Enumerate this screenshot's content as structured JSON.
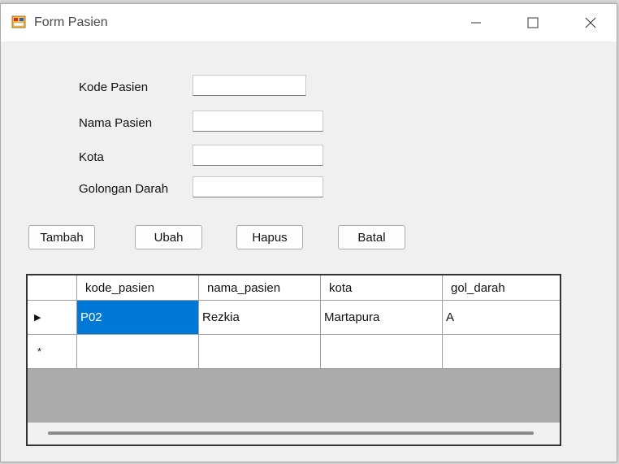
{
  "window": {
    "title": "Form Pasien",
    "controls": {
      "minimize": "minimize",
      "maximize": "maximize",
      "close": "close"
    }
  },
  "form": {
    "fields": [
      {
        "label": "Kode Pasien",
        "value": ""
      },
      {
        "label": "Nama Pasien",
        "value": ""
      },
      {
        "label": "Kota",
        "value": ""
      },
      {
        "label": "Golongan Darah",
        "value": ""
      }
    ]
  },
  "buttons": {
    "tambah": "Tambah",
    "ubah": "Ubah",
    "hapus": "Hapus",
    "batal": "Batal"
  },
  "grid": {
    "columns": [
      "kode_pasien",
      "nama_pasien",
      "kota",
      "gol_darah"
    ],
    "rows": [
      [
        "P02",
        "Rezkia",
        "Martapura",
        "A"
      ]
    ],
    "current_row_marker": "▶",
    "new_row_marker": "*",
    "selection_color": "#0078d7"
  }
}
